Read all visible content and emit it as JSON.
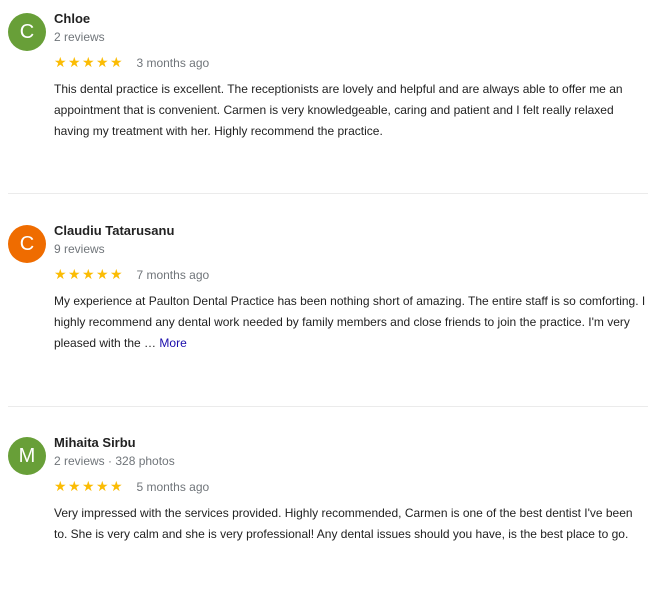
{
  "reviews": [
    {
      "avatar_letter": "C",
      "avatar_color": "#689f38",
      "name": "Chloe",
      "meta": "2 reviews",
      "stars": 5,
      "time": "3 months ago",
      "text": "This dental practice is excellent. The receptionists are lovely and helpful and are always able to offer me an appointment that is convenient. Carmen is very knowledgeable, caring and patient and I felt really relaxed having my treatment with her. Highly recommend the practice."
    },
    {
      "avatar_letter": "C",
      "avatar_color": "#ef6c00",
      "name": "Claudiu Tatarusanu",
      "meta": "9 reviews",
      "stars": 5,
      "time": "7 months ago",
      "text": "My experience at Paulton Dental Practice has been nothing short of amazing. The entire staff is so comforting. I highly recommend any dental work needed by family members and close friends to join the practice. I'm very pleased with the …",
      "more_label": "More"
    },
    {
      "avatar_letter": "M",
      "avatar_color": "#689f38",
      "name": "Mihaita Sirbu",
      "meta": "2 reviews · 328 photos",
      "stars": 5,
      "time": "5 months ago",
      "text": "Very impressed with the services provided. Highly recommended, Carmen is one of the best dentist I've been to. She is very calm and she is very professional! Any dental issues should you have, is the best place to go."
    }
  ]
}
